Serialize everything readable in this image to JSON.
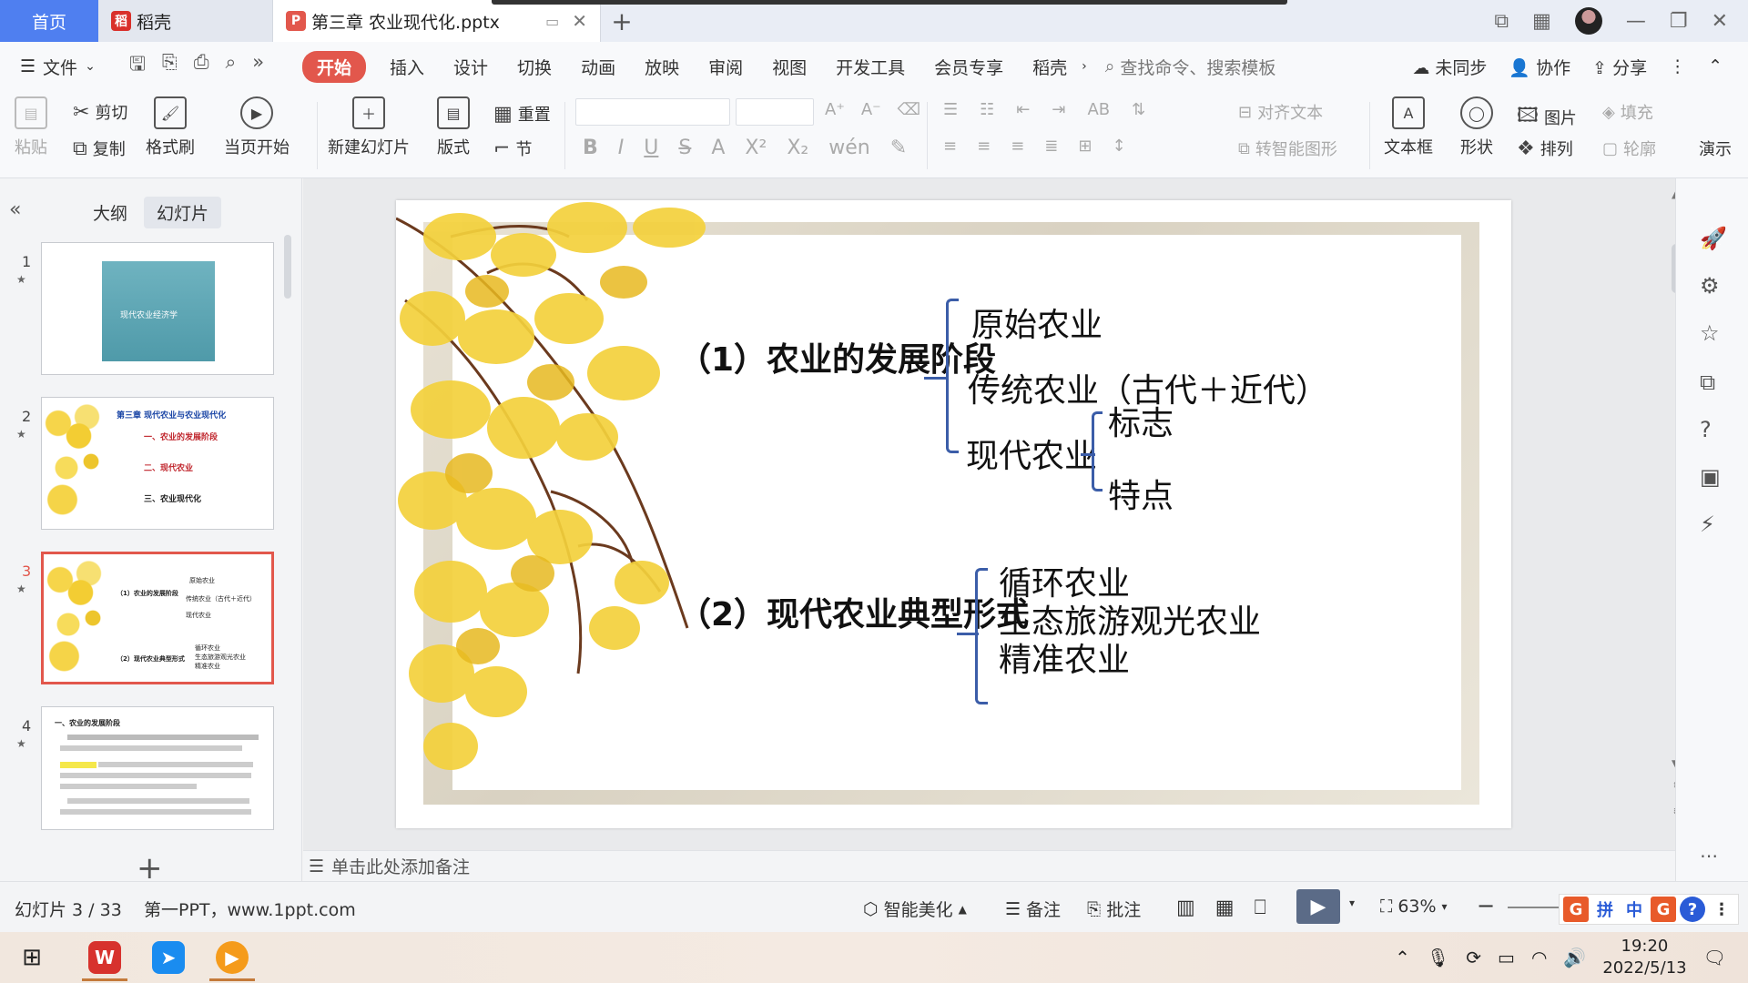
{
  "tabs": {
    "home": "首页",
    "daoke": "稻壳",
    "document": "第三章  农业现代化.pptx",
    "new_tab_symbol": "+"
  },
  "menu": {
    "file": "文件",
    "items": [
      "开始",
      "插入",
      "设计",
      "切换",
      "动画",
      "放映",
      "审阅",
      "视图",
      "开发工具",
      "会员专享",
      "稻壳"
    ],
    "search_placeholder": "查找命令、搜索模板",
    "sync": "未同步",
    "collab": "协作",
    "share": "分享"
  },
  "ribbon": {
    "paste": "粘贴",
    "cut": "剪切",
    "copy": "复制",
    "format_painter": "格式刷",
    "start_from_current": "当页开始",
    "new_slide": "新建幻灯片",
    "layout": "版式",
    "section": "节",
    "reset": "重置",
    "align_text": "对齐文本",
    "smart_shape": "转智能图形",
    "textbox": "文本框",
    "shape": "形状",
    "picture": "图片",
    "arrange": "排列",
    "fill": "填充",
    "outline": "轮廓",
    "presentation": "演示"
  },
  "left_panel": {
    "tab_outline": "大纲",
    "tab_slides": "幻灯片",
    "slides": [
      {
        "num": "1",
        "title": "现代农业经济学"
      },
      {
        "num": "2",
        "title": "第三章  现代农业与农业现代化",
        "items": [
          "一、农业的发展阶段",
          "二、现代农业",
          "三、农业现代化"
        ]
      },
      {
        "num": "3"
      },
      {
        "num": "4",
        "heading": "一、农业的发展阶段"
      }
    ]
  },
  "slide": {
    "heading1": "（1）农业的发展阶段",
    "stage1": "原始农业",
    "stage2": "传统农业（古代＋近代）",
    "stage3": "现代农业",
    "stage3_sub1": "标志",
    "stage3_sub2": "特点",
    "heading2": "（2）现代农业典型形式",
    "form1": "循环农业",
    "form2": "生态旅游观光农业",
    "form3": "精准农业"
  },
  "notes_placeholder": "单击此处添加备注",
  "status": {
    "slide_counter": "幻灯片 3 / 33",
    "template": "第一PPT，www.1ppt.com",
    "beautify": "智能美化",
    "notes": "备注",
    "comments": "批注",
    "zoom": "63%"
  },
  "taskbar": {
    "time": "19:20",
    "date": "2022/5/13"
  },
  "colors": {
    "accent_red": "#e2574c",
    "brace_blue": "#3b5da8",
    "home_tab_blue": "#4f7ff0"
  }
}
